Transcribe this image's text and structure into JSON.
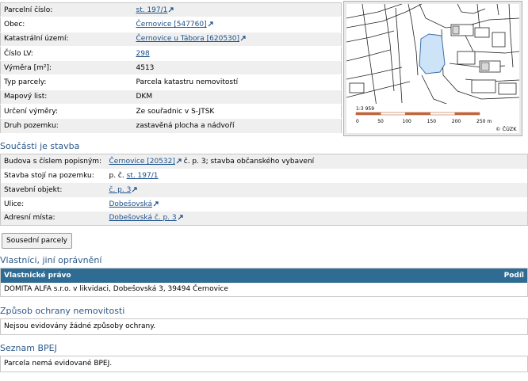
{
  "parcel": {
    "rows": [
      {
        "label": "Parcelní číslo:",
        "value": "st. 197/1",
        "link": true
      },
      {
        "label": "Obec:",
        "value": "Černovice [547760]",
        "link": true
      },
      {
        "label": "Katastrální území:",
        "value": "Černovice u Tábora [620530]",
        "link": true
      },
      {
        "label": "Číslo LV:",
        "value": "298",
        "link": true
      },
      {
        "label": "Výměra [m²]:",
        "value": "4513",
        "link": false
      },
      {
        "label": "Typ parcely:",
        "value": "Parcela katastru nemovitostí",
        "link": false
      },
      {
        "label": "Mapový list:",
        "value": "DKM",
        "link": false
      },
      {
        "label": "Určení výměry:",
        "value": "Ze souřadnic v S-JTSK",
        "link": false
      },
      {
        "label": "Druh pozemku:",
        "value": "zastavěná plocha a nádvoří",
        "link": false
      }
    ]
  },
  "map": {
    "scale_text": "1:3 959",
    "scale_ticks": [
      "0",
      "50",
      "100",
      "150",
      "200",
      "250 m"
    ],
    "copyright": "© ČÚZK",
    "parcel_color": "#cce3f8",
    "scale_color": "#c0653a"
  },
  "building": {
    "title": "Součásti je stavba",
    "rows": {
      "budova_label": "Budova s číslem popisným:",
      "budova_link": "Černovice [20532]",
      "budova_rest": " č. p. 3; stavba občanského vybavení",
      "stavba_label": "Stavba stojí na pozemku:",
      "stavba_prefix": "p. č. ",
      "stavba_link": "st. 197/1",
      "objekt_label": "Stavební objekt:",
      "objekt_link": "č. p. 3",
      "ulice_label": "Ulice:",
      "ulice_link": "Dobešovská",
      "adresni_label": "Adresní místa:",
      "adresni_link": "Dobešovská č. p. 3"
    }
  },
  "neighbors_button": "Sousední parcely",
  "owners": {
    "title": "Vlastníci, jiní oprávnění",
    "col_left": "Vlastnické právo",
    "col_right": "Podíl",
    "row": "DOMITA ALFA s.r.o. v likvidaci, Dobešovská 3, 39494 Černovice"
  },
  "protection": {
    "title": "Způsob ochrany nemovitosti",
    "text": "Nejsou evidovány žádné způsoby ochrany."
  },
  "bpej": {
    "title": "Seznam BPEJ",
    "text": "Parcela nemá evidované BPEJ."
  }
}
